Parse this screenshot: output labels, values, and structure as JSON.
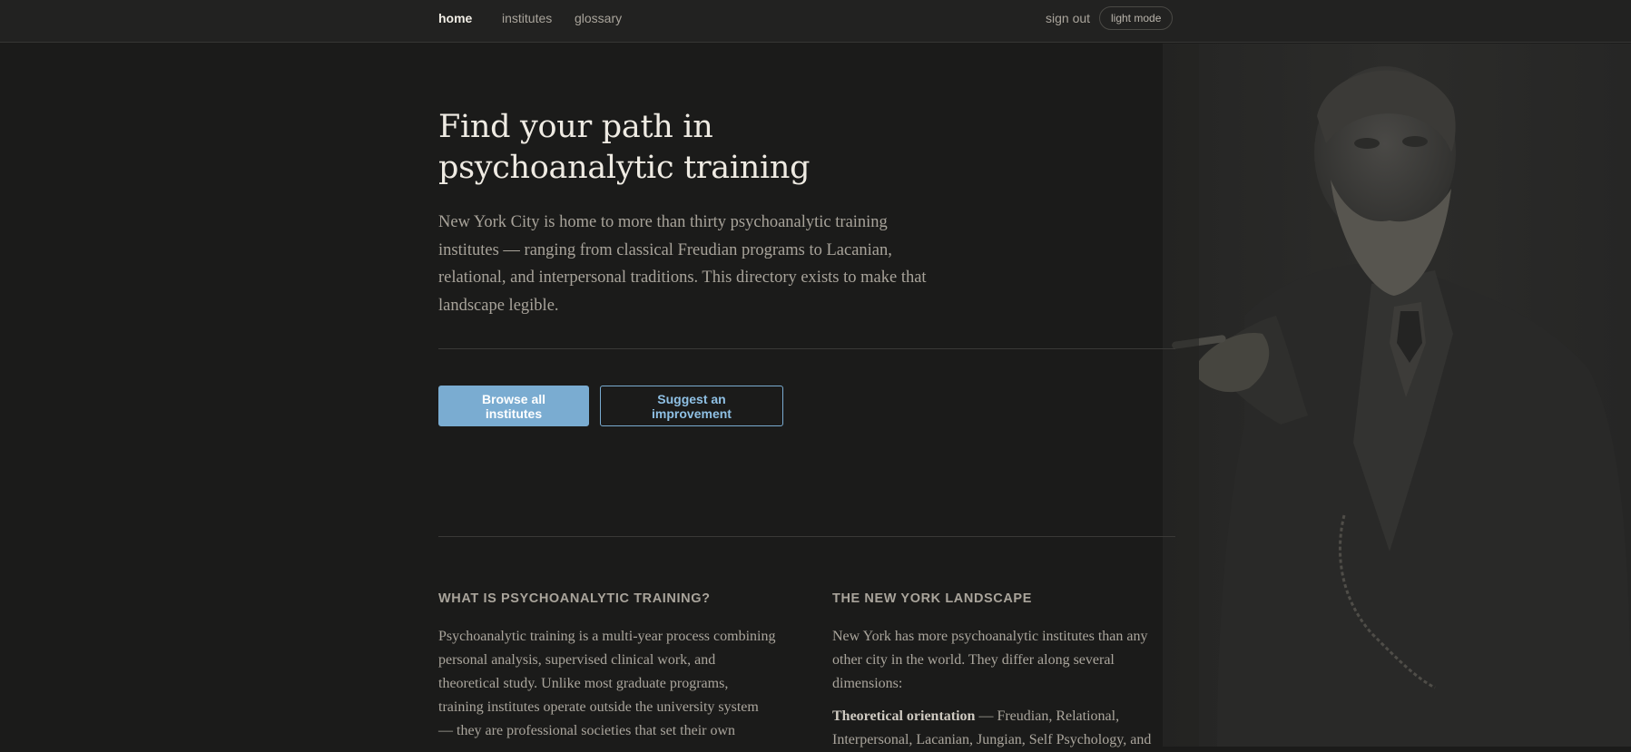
{
  "nav": {
    "home": "home",
    "institutes": "institutes",
    "glossary": "glossary",
    "sign_out": "sign out",
    "mode_toggle": "light mode"
  },
  "hero": {
    "title": "Find your path in psychoanalytic training",
    "lead": "New York City is home to more than thirty psychoanalytic training institutes — ranging from classical Freudian programs to Lacanian, relational, and interpersonal traditions. This directory exists to make that landscape legible."
  },
  "actions": {
    "browse": "Browse all institutes",
    "suggest": "Suggest an improvement"
  },
  "sections": {
    "left": {
      "heading": "WHAT IS PSYCHOANALYTIC TRAINING?",
      "body": "Psychoanalytic training is a multi-year process combining personal analysis, supervised clinical work, and theoretical study. Unlike most graduate programs, training institutes operate outside the university system — they are professional societies that set their own"
    },
    "right": {
      "heading": "THE NEW YORK LANDSCAPE",
      "body": "New York has more psychoanalytic institutes than any other city in the world. They differ along several dimensions:",
      "item_label": "Theoretical orientation",
      "item_text": " — Freudian, Relational, Interpersonal, Lacanian, Jungian, Self Psychology, and"
    }
  },
  "colors": {
    "background": "#1b1b1a",
    "nav_background": "#222221",
    "accent": "#7aacd1",
    "text_primary": "#efebe3",
    "text_muted": "#a8a39a"
  },
  "icons": {
    "portrait": "portrait-photo"
  }
}
